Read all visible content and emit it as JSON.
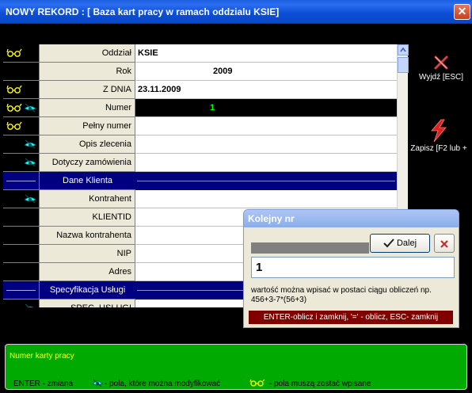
{
  "window": {
    "title": "NOWY REKORD : [  Baza kart pracy w ramach oddzialu   KSIE]",
    "close_label": "✕"
  },
  "rows": [
    {
      "label": "Oddział",
      "value": "KSIE",
      "glasses": true,
      "eye": false,
      "section": false
    },
    {
      "label": "Rok",
      "value": "2009",
      "glasses": false,
      "eye": false,
      "section": false
    },
    {
      "label": "Z DNIA",
      "value": "23.11.2009",
      "glasses": true,
      "eye": false,
      "section": false
    },
    {
      "label": "Numer",
      "value": "1",
      "glasses": true,
      "eye": true,
      "section": false
    },
    {
      "label": "Pełny numer",
      "value": "",
      "glasses": true,
      "eye": false,
      "section": false
    },
    {
      "label": "Opis zlecenia",
      "value": "",
      "glasses": false,
      "eye": true,
      "section": false
    },
    {
      "label": "Dotyczy zamówienia",
      "value": "",
      "glasses": false,
      "eye": true,
      "section": false
    },
    {
      "label": "Dane Klienta",
      "value": "",
      "glasses": false,
      "eye": false,
      "section": true
    },
    {
      "label": "Kontrahent",
      "value": "",
      "glasses": false,
      "eye": true,
      "section": false
    },
    {
      "label": "KLIENTID",
      "value": "",
      "glasses": false,
      "eye": false,
      "section": false
    },
    {
      "label": "Nazwa kontrahenta",
      "value": "",
      "glasses": false,
      "eye": false,
      "section": false
    },
    {
      "label": "NIP",
      "value": "",
      "glasses": false,
      "eye": false,
      "section": false
    },
    {
      "label": "Adres",
      "value": "",
      "glasses": false,
      "eye": false,
      "section": false
    },
    {
      "label": "Specyfikacja Usługi",
      "value": "",
      "glasses": false,
      "eye": false,
      "section": true
    },
    {
      "label": "SPEC_USLUGI",
      "value": "",
      "glasses": false,
      "eye": true,
      "section": false
    }
  ],
  "side": {
    "exit_label": "Wyjdź [ESC]",
    "save_label": "Zapisz [F2 lub +"
  },
  "popup": {
    "title": "Kolejny nr",
    "dalej_label": "Dalej",
    "input_value": "1",
    "hint": "wartość można wpisać w postaci ciągu obliczeń np. 456+3-7*(56+3)",
    "status": "ENTER-oblicz i zamknij,  '=' - oblicz, ESC- zamknij"
  },
  "help": {
    "title": "Numer karty pracy",
    "legend_enter": "ENTER - zmiana",
    "legend_eye": "- pola, które można modyfikować",
    "legend_glasses": "- pola muszą zostać wpisane"
  },
  "colors": {
    "section_bg": "#000080",
    "number_bg": "#000000",
    "number_fg": "#00ff00",
    "help_bg": "#00aa00",
    "help_title": "#ffff00",
    "status_bg": "#800000"
  },
  "icons": {
    "glasses": "glasses-icon",
    "eye": "eye-icon",
    "exit": "exit-icon",
    "save": "lightning-icon"
  }
}
